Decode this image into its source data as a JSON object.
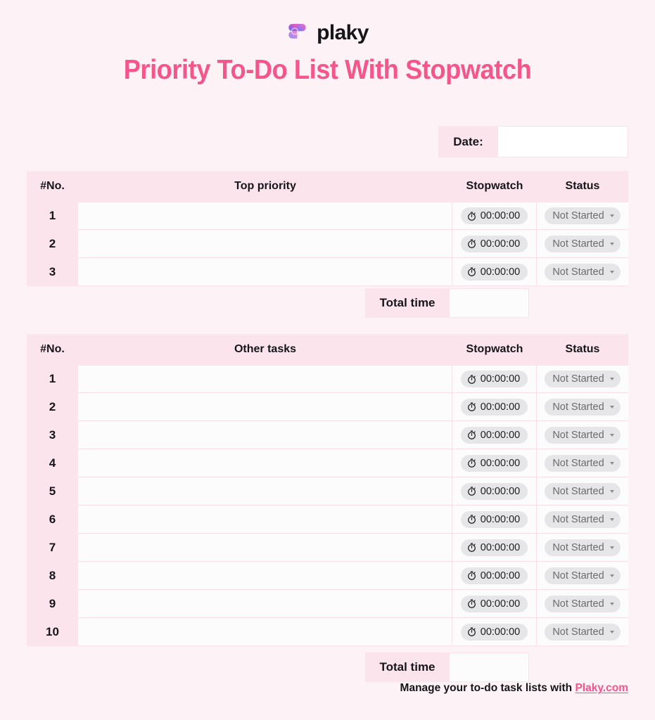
{
  "brand": {
    "name": "plaky",
    "logo_icon": "plaky-logo-icon",
    "gradient_from": "#5b6ef5",
    "gradient_to": "#ff5fa2"
  },
  "title": "Priority To-Do List With Stopwatch",
  "colors": {
    "page_background": "#fdf2f5",
    "accent_pink": "#f4568a",
    "header_pink": "#fce4ec",
    "border_pink": "#fbe2e9",
    "pill_grey": "#e6e6e8",
    "text_dark": "#16151a"
  },
  "date_field": {
    "label": "Date:",
    "value": "",
    "placeholder": ""
  },
  "priority_table": {
    "headers": {
      "no": "#No.",
      "task": "Top priority",
      "stopwatch": "Stopwatch",
      "status": "Status"
    },
    "rows": [
      {
        "no": "1",
        "task": "",
        "stopwatch": "00:00:00",
        "status": "Not Started"
      },
      {
        "no": "2",
        "task": "",
        "stopwatch": "00:00:00",
        "status": "Not Started"
      },
      {
        "no": "3",
        "task": "",
        "stopwatch": "00:00:00",
        "status": "Not Started"
      }
    ],
    "total": {
      "label": "Total time",
      "value": ""
    }
  },
  "other_table": {
    "headers": {
      "no": "#No.",
      "task": "Other tasks",
      "stopwatch": "Stopwatch",
      "status": "Status"
    },
    "rows": [
      {
        "no": "1",
        "task": "",
        "stopwatch": "00:00:00",
        "status": "Not Started"
      },
      {
        "no": "2",
        "task": "",
        "stopwatch": "00:00:00",
        "status": "Not Started"
      },
      {
        "no": "3",
        "task": "",
        "stopwatch": "00:00:00",
        "status": "Not Started"
      },
      {
        "no": "4",
        "task": "",
        "stopwatch": "00:00:00",
        "status": "Not Started"
      },
      {
        "no": "5",
        "task": "",
        "stopwatch": "00:00:00",
        "status": "Not Started"
      },
      {
        "no": "6",
        "task": "",
        "stopwatch": "00:00:00",
        "status": "Not Started"
      },
      {
        "no": "7",
        "task": "",
        "stopwatch": "00:00:00",
        "status": "Not Started"
      },
      {
        "no": "8",
        "task": "",
        "stopwatch": "00:00:00",
        "status": "Not Started"
      },
      {
        "no": "9",
        "task": "",
        "stopwatch": "00:00:00",
        "status": "Not Started"
      },
      {
        "no": "10",
        "task": "",
        "stopwatch": "00:00:00",
        "status": "Not Started"
      }
    ],
    "total": {
      "label": "Total time",
      "value": ""
    }
  },
  "footer": {
    "text": "Manage your to-do task lists with ",
    "link_text": "Plaky.com"
  },
  "icons": {
    "stopwatch": "stopwatch-icon",
    "caret": "chevron-down-icon"
  }
}
